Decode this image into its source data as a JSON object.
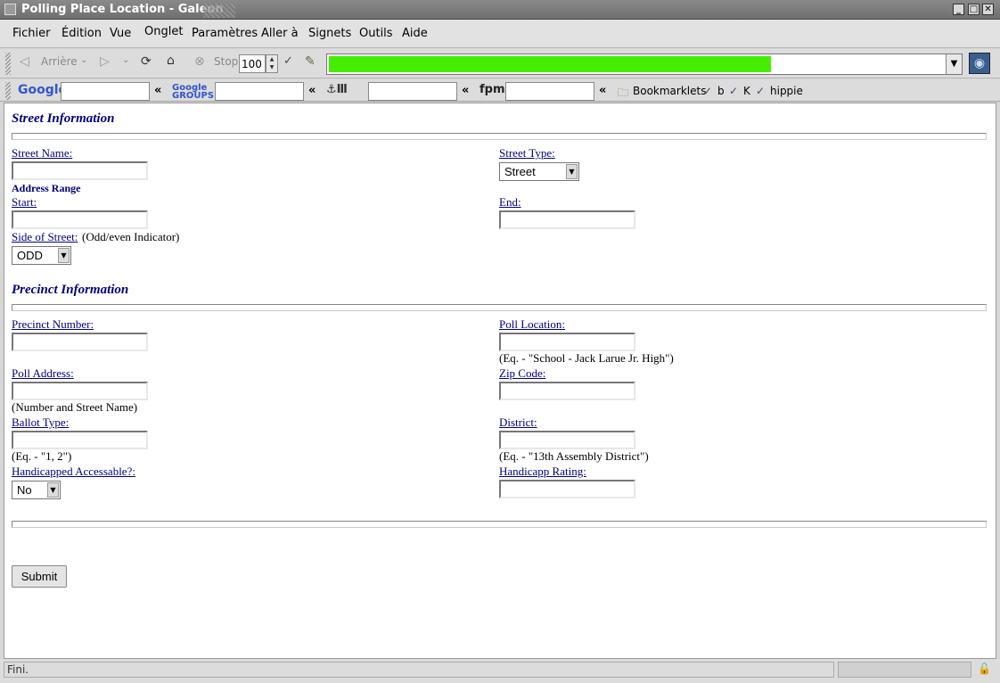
{
  "window": {
    "title": "Polling Place Location - Galeon",
    "controls": [
      "_",
      "□",
      "✕"
    ]
  },
  "menu": {
    "items": [
      "Fichier",
      "Édition",
      "Vue",
      "Onglet",
      "Paramètres",
      "Aller à",
      "Signets",
      "Outils",
      "Aide"
    ]
  },
  "nav": {
    "back_label": "Arrière",
    "stop_label": "Stop",
    "zoom_value": "100",
    "load_progress": 0.7
  },
  "searchbar": {
    "google_logo": "Google",
    "groups_logo": "Google GROUPS",
    "fpm_logo": "fpm",
    "sep": "«",
    "bookmarklets_label": "Bookmarklets",
    "bm_b": "b",
    "bm_k": "K",
    "bm_hippie": "hippie"
  },
  "form": {
    "street_heading": "Street Information",
    "street_name_label": "Street Name:",
    "street_type_label": "Street Type:",
    "street_type_value": "Street",
    "address_range_label": "Address Range",
    "start_label": "Start:",
    "end_label": "End:",
    "side_label": "Side of Street:",
    "side_hint": "(Odd/even Indicator)",
    "side_value": "ODD",
    "precinct_heading": "Precinct Information",
    "precinct_number_label": "Precinct Number:",
    "poll_location_label": "Poll Location:",
    "poll_location_hint": "(Eq. - \"School - Jack Larue Jr. High\")",
    "poll_address_label": "Poll Address:",
    "poll_address_hint": "(Number and Street Name)",
    "zip_label": "Zip Code:",
    "ballot_type_label": "Ballot Type:",
    "ballot_type_hint": "(Eq. - \"1, 2\")",
    "district_label": "District:",
    "district_hint": "(Eq. - \"13th Assembly District\")",
    "handicapped_label": "Handicapped Accessable?:",
    "handicapped_value": "No",
    "handicapp_rating_label": "Handicapp Rating:",
    "submit_label": "Submit"
  },
  "status": {
    "text": "Fini."
  }
}
